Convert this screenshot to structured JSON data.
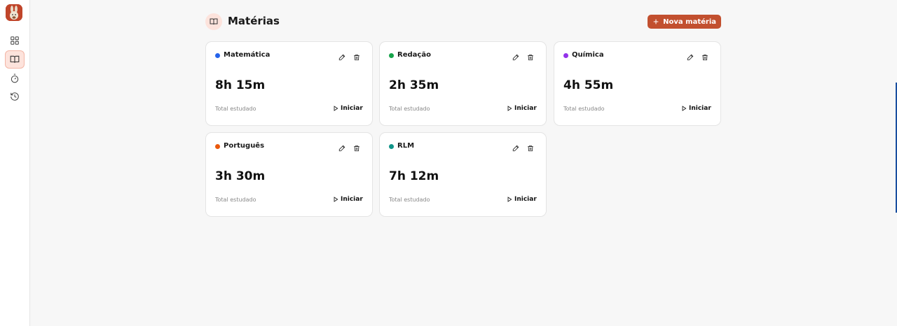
{
  "header": {
    "title": "Matérias",
    "new_button_label": "Nova matéria"
  },
  "sidebar": {
    "items": [
      {
        "icon": "grid-icon",
        "active": false
      },
      {
        "icon": "book-icon",
        "active": true
      },
      {
        "icon": "timer-icon",
        "active": false
      },
      {
        "icon": "history-icon",
        "active": false
      }
    ]
  },
  "subjects": [
    {
      "name": "Matemática",
      "color": "#2563eb",
      "time": "8h 15m",
      "total_label": "Total estudado",
      "start_label": "Iniciar"
    },
    {
      "name": "Redação",
      "color": "#16a34a",
      "time": "2h 35m",
      "total_label": "Total estudado",
      "start_label": "Iniciar"
    },
    {
      "name": "Química",
      "color": "#9333ea",
      "time": "4h 55m",
      "total_label": "Total estudado",
      "start_label": "Iniciar"
    },
    {
      "name": "Português",
      "color": "#ea580c",
      "time": "3h 30m",
      "total_label": "Total estudado",
      "start_label": "Iniciar"
    },
    {
      "name": "RLM",
      "color": "#0f9488",
      "time": "7h 12m",
      "total_label": "Total estudado",
      "start_label": "Iniciar"
    }
  ],
  "colors": {
    "accent": "#c2502f",
    "accent_light": "#fde3dc"
  }
}
